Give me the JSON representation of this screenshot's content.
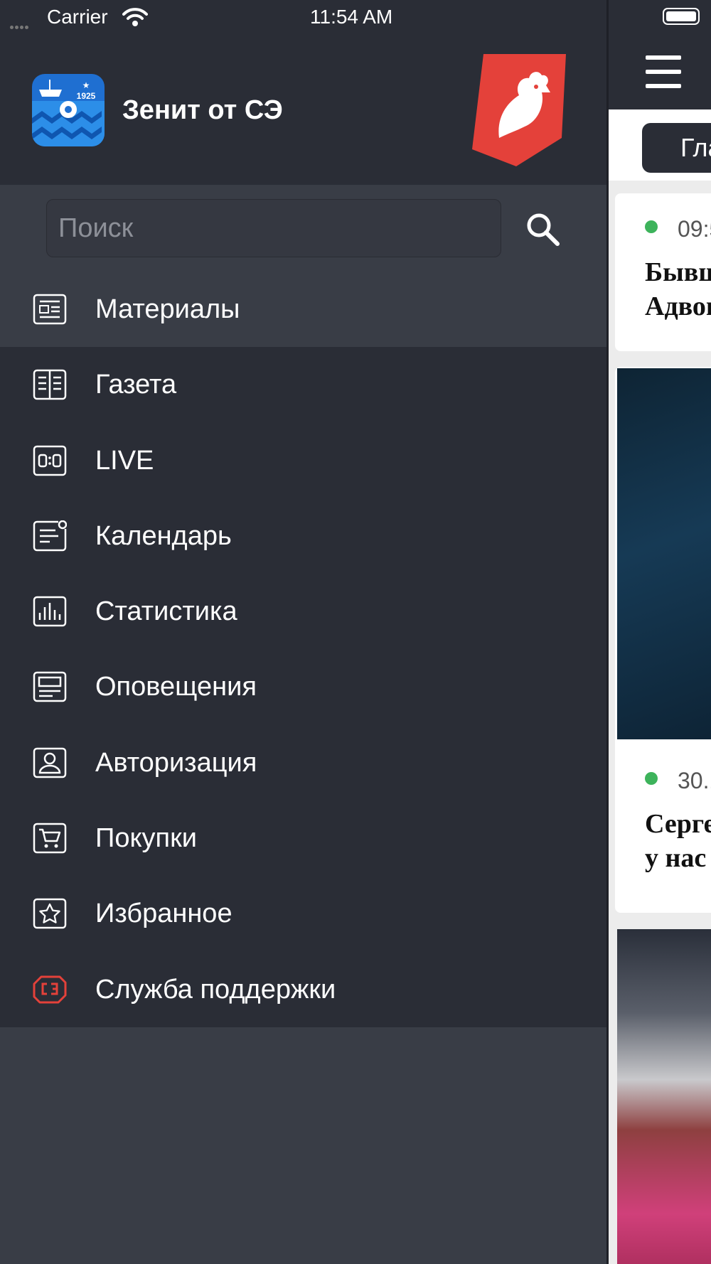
{
  "status_bar": {
    "carrier": "Carrier",
    "time": "11:54 AM"
  },
  "drawer": {
    "app_title": "Зенит от СЭ",
    "search": {
      "placeholder": "Поиск"
    },
    "menu": [
      {
        "label": "Материалы",
        "icon": "materials-icon",
        "active": true
      },
      {
        "label": "Газета",
        "icon": "newspaper-icon"
      },
      {
        "label": "LIVE",
        "icon": "scoreboard-icon"
      },
      {
        "label": "Календарь",
        "icon": "calendar-icon"
      },
      {
        "label": "Статистика",
        "icon": "statistics-icon"
      },
      {
        "label": "Оповещения",
        "icon": "notifications-icon"
      },
      {
        "label": "Авторизация",
        "icon": "user-icon"
      },
      {
        "label": "Покупки",
        "icon": "cart-icon"
      },
      {
        "label": "Избранное",
        "icon": "star-icon"
      },
      {
        "label": "Служба поддержки",
        "icon": "support-icon",
        "accent": "#e4413a"
      }
    ]
  },
  "content": {
    "tab_label": "Гла",
    "cards": [
      {
        "time": "09:5",
        "headline_lines": [
          "Бывш",
          "Адвон"
        ]
      },
      {
        "time": "30.1",
        "headline_lines": [
          "Серге",
          "у нас"
        ]
      }
    ]
  },
  "colors": {
    "drawer_bg": "#2a2d36",
    "active_bg": "#393d46",
    "accent_red": "#e4413a",
    "live_dot": "#3db35b"
  }
}
